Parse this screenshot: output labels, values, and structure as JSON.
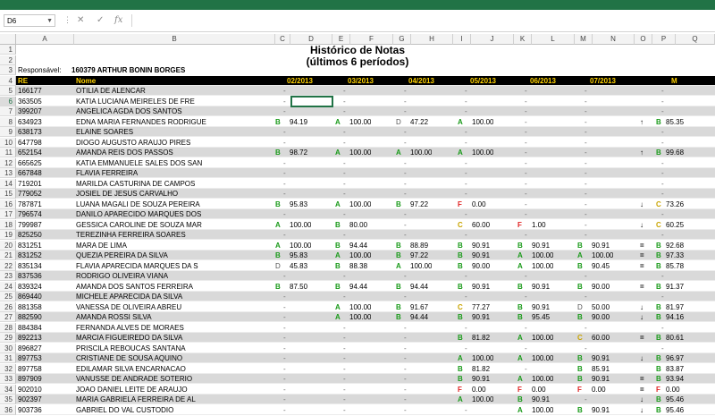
{
  "namebox": "D6",
  "formula_icons": {
    "cancel": "✕",
    "enter": "✓",
    "fx": "fx"
  },
  "columns": [
    "A",
    "B",
    "C",
    "D",
    "E",
    "F",
    "G",
    "H",
    "I",
    "J",
    "K",
    "L",
    "M",
    "N",
    "O",
    "P",
    "Q"
  ],
  "rownums": [
    "1",
    "2",
    "3",
    "4",
    "5",
    "6",
    "7",
    "8",
    "9",
    "10",
    "11",
    "12",
    "13",
    "14",
    "15",
    "16",
    "17",
    "18",
    "19",
    "20",
    "21",
    "22",
    "23",
    "24",
    "25",
    "26",
    "27",
    "28",
    "29",
    "30",
    "31",
    "32",
    "33",
    "34",
    "35",
    "36"
  ],
  "title1": "Histórico de Notas",
  "title2": "(últimos 6 períodos)",
  "responsavel_label": "Responsável:",
  "responsavel_value": "160379 ARTHUR BONIN BORGES",
  "header": {
    "re": "RE",
    "nome": "Nome",
    "p1": "02/2013",
    "p2": "03/2013",
    "p3": "04/2013",
    "p4": "05/2013",
    "p5": "06/2013",
    "p6": "07/2013",
    "m": "M"
  },
  "rows": [
    {
      "re": "166177",
      "nome": "OTILIA DE ALENCAR",
      "v": [
        "-",
        "-",
        "-",
        "-",
        "-",
        "-"
      ],
      "arrow": "",
      "m": "-"
    },
    {
      "re": "363505",
      "nome": "KATIA LUCIANA MEIRELES DE FRE",
      "v": [
        "-",
        "-",
        "-",
        "-",
        "-",
        "-"
      ],
      "arrow": "",
      "m": "-"
    },
    {
      "re": "399207",
      "nome": "ANGELICA AGDA DOS SANTOS",
      "v": [
        "-",
        "-",
        "-",
        "-",
        "-",
        "-"
      ],
      "arrow": "",
      "m": "-"
    },
    {
      "re": "634923",
      "nome": "EDNA MARIA FERNANDES RODRIGUE",
      "v": [
        "B|94.19",
        "A|100.00",
        "D|47.22",
        "A|100.00",
        "-",
        "-"
      ],
      "arrow": "↑",
      "m": "B|85.35"
    },
    {
      "re": "638173",
      "nome": "ELAINE SOARES",
      "v": [
        "-",
        "-",
        "-",
        "-",
        "-",
        "-"
      ],
      "arrow": "",
      "m": "-"
    },
    {
      "re": "647798",
      "nome": "DIOGO AUGUSTO ARAUJO PIRES",
      "v": [
        "-",
        "-",
        "-",
        "-",
        "-",
        "-"
      ],
      "arrow": "",
      "m": "-"
    },
    {
      "re": "652154",
      "nome": "AMANDA REIS DOS PASSOS",
      "v": [
        "B|98.72",
        "A|100.00",
        "A|100.00",
        "A|100.00",
        "-",
        "-"
      ],
      "arrow": "↑",
      "m": "B|99.68"
    },
    {
      "re": "665625",
      "nome": "KATIA EMMANUELE SALES DOS SAN",
      "v": [
        "-",
        "-",
        "-",
        "-",
        "-",
        "-"
      ],
      "arrow": "",
      "m": "-"
    },
    {
      "re": "667848",
      "nome": "FLAVIA FERREIRA",
      "v": [
        "-",
        "-",
        "-",
        "-",
        "-",
        "-"
      ],
      "arrow": "",
      "m": "-"
    },
    {
      "re": "719201",
      "nome": "MARILDA CASTURINA DE CAMPOS",
      "v": [
        "-",
        "-",
        "-",
        "-",
        "-",
        "-"
      ],
      "arrow": "",
      "m": "-"
    },
    {
      "re": "779052",
      "nome": "JOSIEL DE JESUS CARVALHO",
      "v": [
        "-",
        "-",
        "-",
        "-",
        "-",
        "-"
      ],
      "arrow": "",
      "m": "-"
    },
    {
      "re": "787871",
      "nome": "LUANA MAGALI DE SOUZA PEREIRA",
      "v": [
        "B|95.83",
        "A|100.00",
        "B|97.22",
        "F|0.00",
        "-",
        "-"
      ],
      "arrow": "↓",
      "m": "C|73.26"
    },
    {
      "re": "796574",
      "nome": "DANILO APARECIDO MARQUES DOS",
      "v": [
        "-",
        "-",
        "-",
        "-",
        "-",
        "-"
      ],
      "arrow": "",
      "m": "-"
    },
    {
      "re": "799987",
      "nome": "GESSICA CAROLINE DE SOUZA MAR",
      "v": [
        "A|100.00",
        "B|80.00",
        "-",
        "C|60.00",
        "F|1.00",
        "-"
      ],
      "arrow": "↓",
      "m": "C|60.25"
    },
    {
      "re": "825250",
      "nome": "TEREZINHA FERREIRA SOARES",
      "v": [
        "-",
        "-",
        "-",
        "-",
        "-",
        "-"
      ],
      "arrow": "",
      "m": "-"
    },
    {
      "re": "831251",
      "nome": "MARA DE LIMA",
      "v": [
        "A|100.00",
        "B|94.44",
        "B|88.89",
        "B|90.91",
        "B|90.91",
        "B|90.91"
      ],
      "arrow": "=",
      "m": "B|92.68"
    },
    {
      "re": "831252",
      "nome": "QUEZIA PEREIRA DA SILVA",
      "v": [
        "B|95.83",
        "A|100.00",
        "B|97.22",
        "B|90.91",
        "A|100.00",
        "A|100.00"
      ],
      "arrow": "=",
      "m": "B|97.33"
    },
    {
      "re": "835134",
      "nome": "FLAVIA APARECIDA MARQUES DA S",
      "v": [
        "D|45.83",
        "B|88.38",
        "A|100.00",
        "B|90.00",
        "A|100.00",
        "B|90.45"
      ],
      "arrow": "=",
      "m": "B|85.78"
    },
    {
      "re": "837536",
      "nome": "RODRIGO OLIVEIRA VIANA",
      "v": [
        "-",
        "-",
        "-",
        "-",
        "-",
        "-"
      ],
      "arrow": "",
      "m": "-"
    },
    {
      "re": "839324",
      "nome": "AMANDA DOS SANTOS FERREIRA",
      "v": [
        "B|87.50",
        "B|94.44",
        "B|94.44",
        "B|90.91",
        "B|90.91",
        "B|90.00"
      ],
      "arrow": "=",
      "m": "B|91.37"
    },
    {
      "re": "869440",
      "nome": "MICHELE APARECIDA DA SILVA",
      "v": [
        "-",
        "-",
        "-",
        "-",
        "-",
        "-"
      ],
      "arrow": "",
      "m": "-"
    },
    {
      "re": "881358",
      "nome": "VANESSA DE OLIVEIRA ABREU",
      "v": [
        "-",
        "A|100.00",
        "B|91.67",
        "C|77.27",
        "B|90.91",
        "D|50.00"
      ],
      "arrow": "↓",
      "m": "B|81.97"
    },
    {
      "re": "882590",
      "nome": "AMANDA ROSSI SILVA",
      "v": [
        "-",
        "A|100.00",
        "B|94.44",
        "B|90.91",
        "B|95.45",
        "B|90.00"
      ],
      "arrow": "↓",
      "m": "B|94.16"
    },
    {
      "re": "884384",
      "nome": "FERNANDA ALVES DE MORAES",
      "v": [
        "-",
        "-",
        "-",
        "-",
        "-",
        "-"
      ],
      "arrow": "",
      "m": "-"
    },
    {
      "re": "892213",
      "nome": "MARCIA FIGUEIREDO DA SILVA",
      "v": [
        "-",
        "-",
        "-",
        "B|81.82",
        "A|100.00",
        "C|60.00"
      ],
      "arrow": "=",
      "m": "B|80.61"
    },
    {
      "re": "896827",
      "nome": "PRISCILA REBOUCAS SANTANA",
      "v": [
        "-",
        "-",
        "-",
        "-",
        "-",
        "-"
      ],
      "arrow": "",
      "m": "-"
    },
    {
      "re": "897753",
      "nome": "CRISTIANE DE SOUSA AQUINO",
      "v": [
        "-",
        "-",
        "-",
        "A|100.00",
        "A|100.00",
        "B|90.91"
      ],
      "arrow": "↓",
      "m": "B|96.97"
    },
    {
      "re": "897758",
      "nome": "EDILAMAR SILVA ENCARNACAO",
      "v": [
        "-",
        "-",
        "-",
        "B|81.82",
        "-",
        "B|85.91"
      ],
      "arrow": "",
      "m": "B|83.87"
    },
    {
      "re": "897909",
      "nome": "VANUSSE DE ANDRADE SOTERIO",
      "v": [
        "-",
        "-",
        "-",
        "B|90.91",
        "A|100.00",
        "B|90.91"
      ],
      "arrow": "=",
      "m": "B|93.94"
    },
    {
      "re": "902010",
      "nome": "JOAO DANIEL LEITE DE ARAUJO",
      "v": [
        "-",
        "-",
        "-",
        "F|0.00",
        "F|0.00",
        "F|0.00"
      ],
      "arrow": "=",
      "m": "F|0.00"
    },
    {
      "re": "902397",
      "nome": "MARIA GABRIELA FERREIRA DE AL",
      "v": [
        "-",
        "-",
        "-",
        "A|100.00",
        "B|90.91",
        "-"
      ],
      "arrow": "↓",
      "m": "B|95.46"
    },
    {
      "re": "903736",
      "nome": "GABRIEL DO VAL CUSTODIO",
      "v": [
        "-",
        "-",
        "-",
        "-",
        "A|100.00",
        "B|90.91"
      ],
      "arrow": "↓",
      "m": "B|95.46"
    }
  ]
}
